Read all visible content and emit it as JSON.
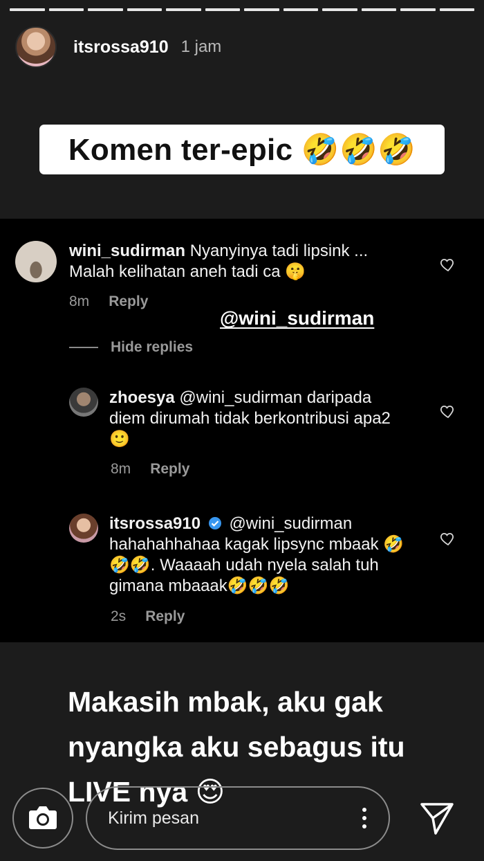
{
  "story": {
    "username": "itsrossa910",
    "time": "1 jam",
    "title": "Komen ter-epic 🤣🤣🤣",
    "progress_segments": 12
  },
  "comments": {
    "c1": {
      "username": "wini_sudirman",
      "text_line1": "Nyanyinya tadi lipsink ...",
      "text_line2": "Malah kelihatan aneh tadi ca 🤫",
      "age": "8m",
      "reply": "Reply"
    },
    "mention_tag": "@wini_sudirman",
    "hide_replies": "Hide replies",
    "c2": {
      "username": "zhoesya",
      "text": "@wini_sudirman daripada diem dirumah tidak berkontribusi apa2🙂",
      "age": "8m",
      "reply": "Reply"
    },
    "c3": {
      "username": "itsrossa910",
      "text": "@wini_sudirman hahahahhahaa kagak lipsync mbaak 🤣🤣🤣. Waaaah udah nyela salah tuh gimana mbaaak🤣🤣🤣",
      "age": "2s",
      "reply": "Reply"
    }
  },
  "caption": "Makasih mbak, aku gak nyangka aku sebagus itu LIVE nya 😍",
  "bottom": {
    "input_placeholder": "Kirim pesan"
  },
  "icons": {
    "camera": "camera-icon",
    "more": "more-vertical-icon",
    "send": "send-icon",
    "heart": "heart-icon",
    "verified": "verified-badge-icon"
  },
  "colors": {
    "background": "#1c1c1c",
    "comments_bg": "#000000",
    "verified": "#3897f0",
    "muted": "#9a9a9a"
  }
}
